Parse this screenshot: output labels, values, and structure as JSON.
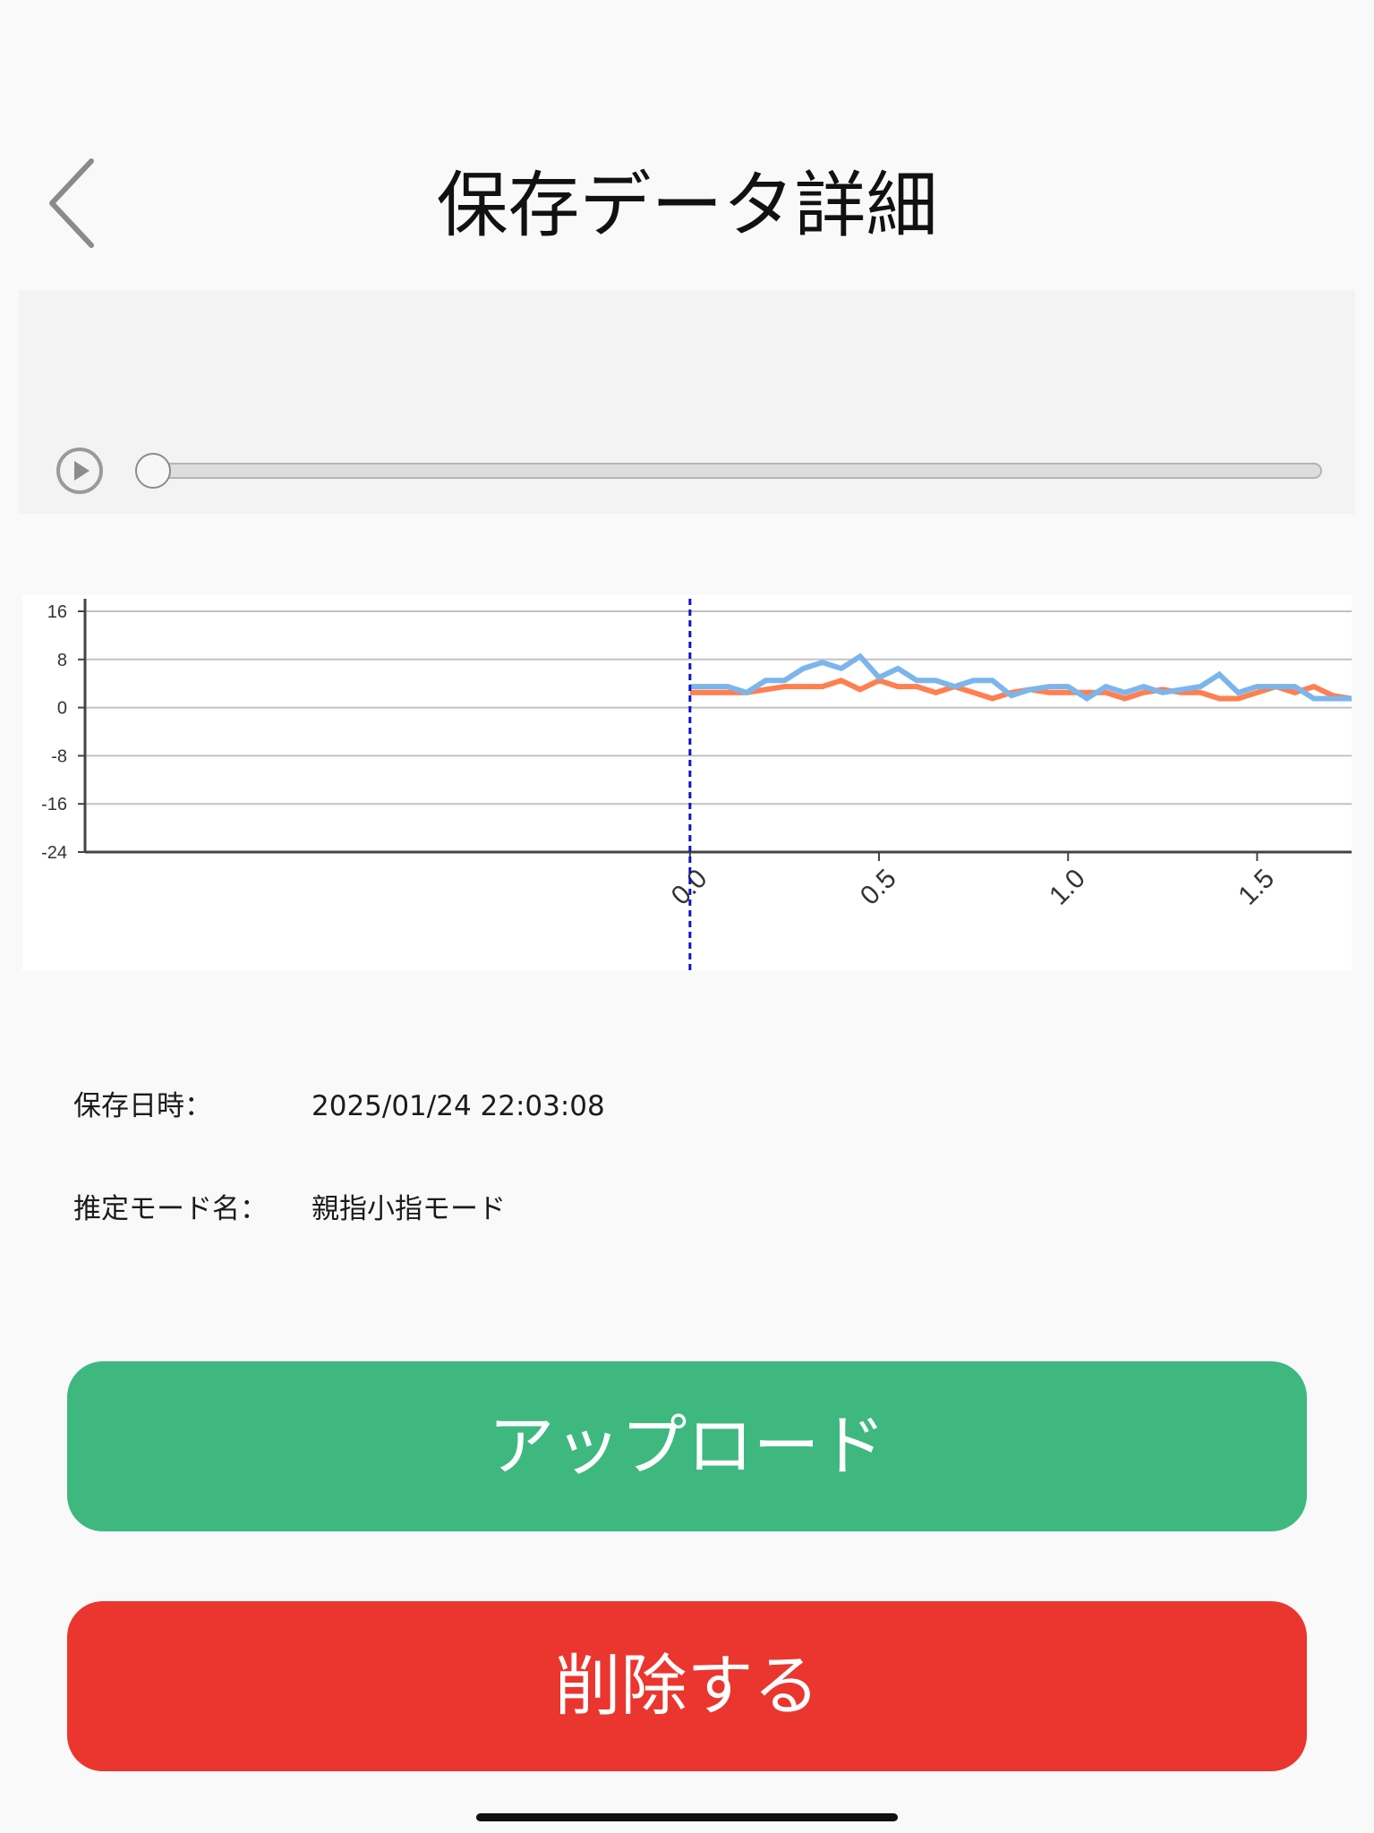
{
  "header": {
    "title": "保存データ詳細",
    "back_icon": "chevron-left-icon"
  },
  "player": {
    "play_icon": "play-circle-icon",
    "progress": 0
  },
  "chart_data": {
    "type": "line",
    "title": "",
    "xlabel": "",
    "ylabel": "",
    "ylim": [
      -24,
      16
    ],
    "xlim": [
      -1.6,
      1.75
    ],
    "y_ticks": [
      "16",
      "8",
      "0",
      "-8",
      "-16",
      "-24"
    ],
    "x_ticks": [
      "0.0",
      "0.5",
      "1.0",
      "1.5"
    ],
    "marker_x": 0.0,
    "grid": true,
    "series": [
      {
        "color": "#ff7f50",
        "x": [
          0,
          0.05,
          0.1,
          0.15,
          0.2,
          0.25,
          0.3,
          0.35,
          0.4,
          0.45,
          0.5,
          0.55,
          0.6,
          0.65,
          0.7,
          0.75,
          0.8,
          0.85,
          0.9,
          0.95,
          1.0,
          1.05,
          1.1,
          1.15,
          1.2,
          1.25,
          1.3,
          1.35,
          1.4,
          1.45,
          1.5,
          1.55,
          1.6,
          1.65,
          1.7,
          1.75
        ],
        "values": [
          2.5,
          2.5,
          2.5,
          2.5,
          3,
          3.5,
          3.5,
          3.5,
          4.5,
          3,
          4.5,
          3.5,
          3.5,
          2.5,
          3.5,
          2.5,
          1.5,
          2.5,
          3,
          2.5,
          2.5,
          2.5,
          2.5,
          1.5,
          2.5,
          3,
          2.5,
          2.5,
          1.5,
          1.5,
          2.5,
          3.5,
          2.5,
          3.5,
          2,
          1.5
        ]
      },
      {
        "color": "#7cb5ec",
        "x": [
          0,
          0.05,
          0.1,
          0.15,
          0.2,
          0.25,
          0.3,
          0.35,
          0.4,
          0.45,
          0.5,
          0.55,
          0.6,
          0.65,
          0.7,
          0.75,
          0.8,
          0.85,
          0.9,
          0.95,
          1.0,
          1.05,
          1.1,
          1.15,
          1.2,
          1.25,
          1.3,
          1.35,
          1.4,
          1.45,
          1.5,
          1.55,
          1.6,
          1.65,
          1.7,
          1.75
        ],
        "values": [
          3.5,
          3.5,
          3.5,
          2.5,
          4.5,
          4.5,
          6.5,
          7.5,
          6.5,
          8.5,
          5,
          6.5,
          4.5,
          4.5,
          3.5,
          4.5,
          4.5,
          2,
          3,
          3.5,
          3.5,
          1.5,
          3.5,
          2.5,
          3.5,
          2.5,
          3,
          3.5,
          5.5,
          2.5,
          3.5,
          3.5,
          3.5,
          1.5,
          1.5,
          1.5
        ]
      }
    ]
  },
  "info": {
    "saved_at_label": "保存日時：",
    "saved_at_value": "2025/01/24 22:03:08",
    "mode_label": "推定モード名：",
    "mode_value": "親指小指モード"
  },
  "actions": {
    "upload_label": "アップロード",
    "delete_label": "削除する"
  }
}
